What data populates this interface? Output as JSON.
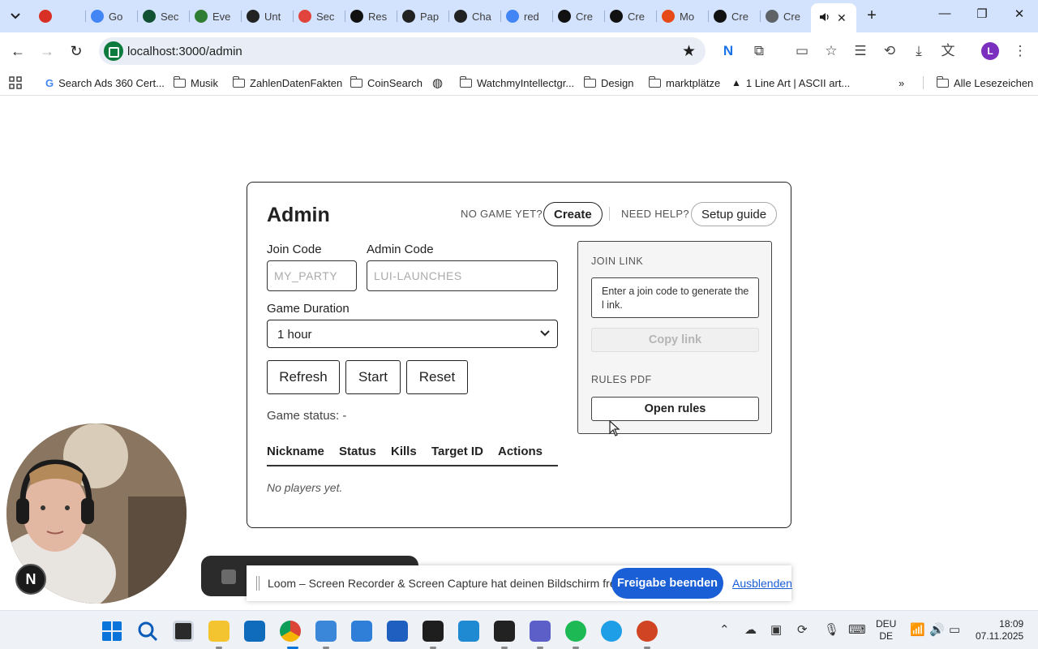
{
  "browser": {
    "tabs": [
      {
        "label": "",
        "icon": "record-icon",
        "color": "#d93025"
      },
      {
        "label": "Go",
        "icon": "google-icon",
        "color": "#4285f4"
      },
      {
        "label": "Sec",
        "icon": "green-app-icon",
        "color": "#0f5132"
      },
      {
        "label": "Eve",
        "icon": "tree-icon",
        "color": "#2e7d32"
      },
      {
        "label": "Unt",
        "icon": "openai-icon",
        "color": "#222222"
      },
      {
        "label": "Sec",
        "icon": "red-swirl-icon",
        "color": "#e0443c"
      },
      {
        "label": "Res",
        "icon": "framer-icon",
        "color": "#111111"
      },
      {
        "label": "Pap",
        "icon": "openai-icon",
        "color": "#222222"
      },
      {
        "label": "Cha",
        "icon": "openai-icon",
        "color": "#222222"
      },
      {
        "label": "red",
        "icon": "google-icon",
        "color": "#4285f4"
      },
      {
        "label": "Cre",
        "icon": "triangle-icon",
        "color": "#111111"
      },
      {
        "label": "Cre",
        "icon": "triangle-icon",
        "color": "#111111"
      },
      {
        "label": "Mo",
        "icon": "rainbow-icon",
        "color": "#e64a19"
      },
      {
        "label": "Cre",
        "icon": "triangle-icon",
        "color": "#111111"
      },
      {
        "label": "Cre",
        "icon": "globe-icon",
        "color": "#5f6368"
      }
    ],
    "active_tab": {
      "label": "(",
      "icon": "speaker-icon"
    },
    "url": "localhost:3000/admin",
    "profile_initial": "L",
    "bookmarks": [
      {
        "label": "Search Ads 360 Cert...",
        "icon": "google-icon"
      },
      {
        "label": "Musik",
        "icon": "folder-icon"
      },
      {
        "label": "ZahlenDatenFakten",
        "icon": "folder-icon"
      },
      {
        "label": "CoinSearch",
        "icon": "folder-icon"
      },
      {
        "label": "",
        "icon": "globe-icon"
      },
      {
        "label": "WatchmyIntellectgr...",
        "icon": "folder-icon"
      },
      {
        "label": "Design",
        "icon": "folder-icon"
      },
      {
        "label": "marktplätze",
        "icon": "folder-icon"
      },
      {
        "label": "1 Line Art | ASCII art...",
        "icon": "ascii-icon"
      }
    ],
    "all_bookmarks": "Alle Lesezeichen"
  },
  "admin": {
    "title": "Admin",
    "no_game_label": "NO GAME YET?",
    "create_button": "Create",
    "need_help_label": "NEED HELP?",
    "setup_button": "Setup guide",
    "join_code_label": "Join Code",
    "join_code_placeholder": "MY_PARTY",
    "join_code_value": "",
    "admin_code_label": "Admin Code",
    "admin_code_placeholder": "LUI-LAUNCHES",
    "admin_code_value": "",
    "duration_label": "Game Duration",
    "duration_selected": "1 hour",
    "refresh_button": "Refresh",
    "start_button": "Start",
    "reset_button": "Reset",
    "game_status": "Game status: -",
    "table": {
      "columns": [
        "Nickname",
        "Status",
        "Kills",
        "Target ID",
        "Actions"
      ],
      "empty_text": "No players yet."
    },
    "panel": {
      "join_link_label": "JOIN LINK",
      "join_link_text": "Enter a join code to generate the l ink.",
      "copy_button": "Copy link",
      "rules_label": "RULES PDF",
      "rules_button": "Open rules"
    }
  },
  "overlay": {
    "webcam_badge": "N",
    "share_text": "Loom – Screen Recorder & Screen Capture hat deinen Bildschirm freigegeben.",
    "stop_share_button": "Freigabe beenden",
    "hide_link": "Ausblenden"
  },
  "taskbar": {
    "lang_line1": "DEU",
    "lang_line2": "DE",
    "time": "18:09",
    "date": "07.11.2025"
  }
}
